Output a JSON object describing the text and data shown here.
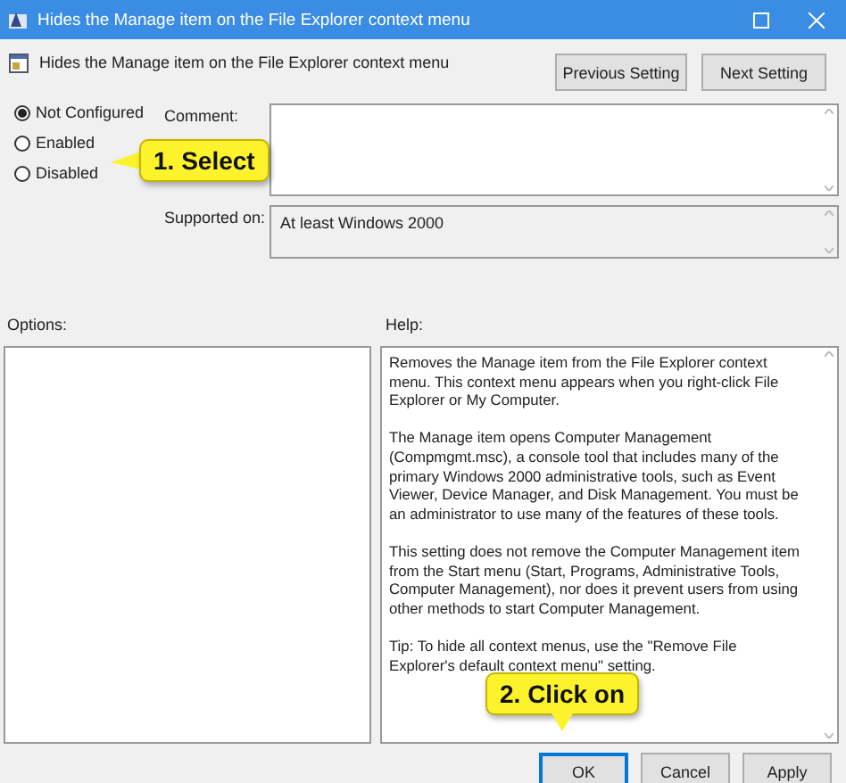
{
  "window": {
    "title": "Hides the Manage item on the File Explorer context menu"
  },
  "header": {
    "title": "Hides the Manage item on the File Explorer context menu",
    "nav_buttons": [
      "Previous Setting",
      "Next Setting"
    ]
  },
  "radios": [
    {
      "label": "Not Configured",
      "selected": true
    },
    {
      "label": "Enabled",
      "selected": false
    },
    {
      "label": "Disabled",
      "selected": false
    }
  ],
  "comment": {
    "label": "Comment:"
  },
  "supported_on": {
    "label": "Supported on:",
    "value": "At least Windows 2000"
  },
  "options": {
    "label": "Options:"
  },
  "help": {
    "label": "Help:",
    "paragraphs": [
      "Removes the Manage item from the File Explorer context menu. This context menu appears when you right-click File Explorer or My Computer.",
      "The Manage item opens Computer Management (Compmgmt.msc), a console tool that includes many of the primary Windows 2000 administrative tools, such as Event Viewer, Device Manager, and Disk Management. You must be an administrator to use many of the features of these tools.",
      "This setting does not remove the Computer Management item from the Start menu (Start, Programs, Administrative Tools, Computer Management), nor does it prevent users from using other methods to start Computer Management.",
      "Tip: To hide all context menus, use the \"Remove File Explorer's default context menu\" setting."
    ]
  },
  "buttons": [
    {
      "label": "OK",
      "default": true
    },
    {
      "label": "Cancel",
      "default": false
    },
    {
      "label": "Apply",
      "default": false
    }
  ],
  "callouts": [
    {
      "text": "1. Select",
      "kind": "left"
    },
    {
      "text": "2. Click on",
      "kind": "down"
    }
  ]
}
